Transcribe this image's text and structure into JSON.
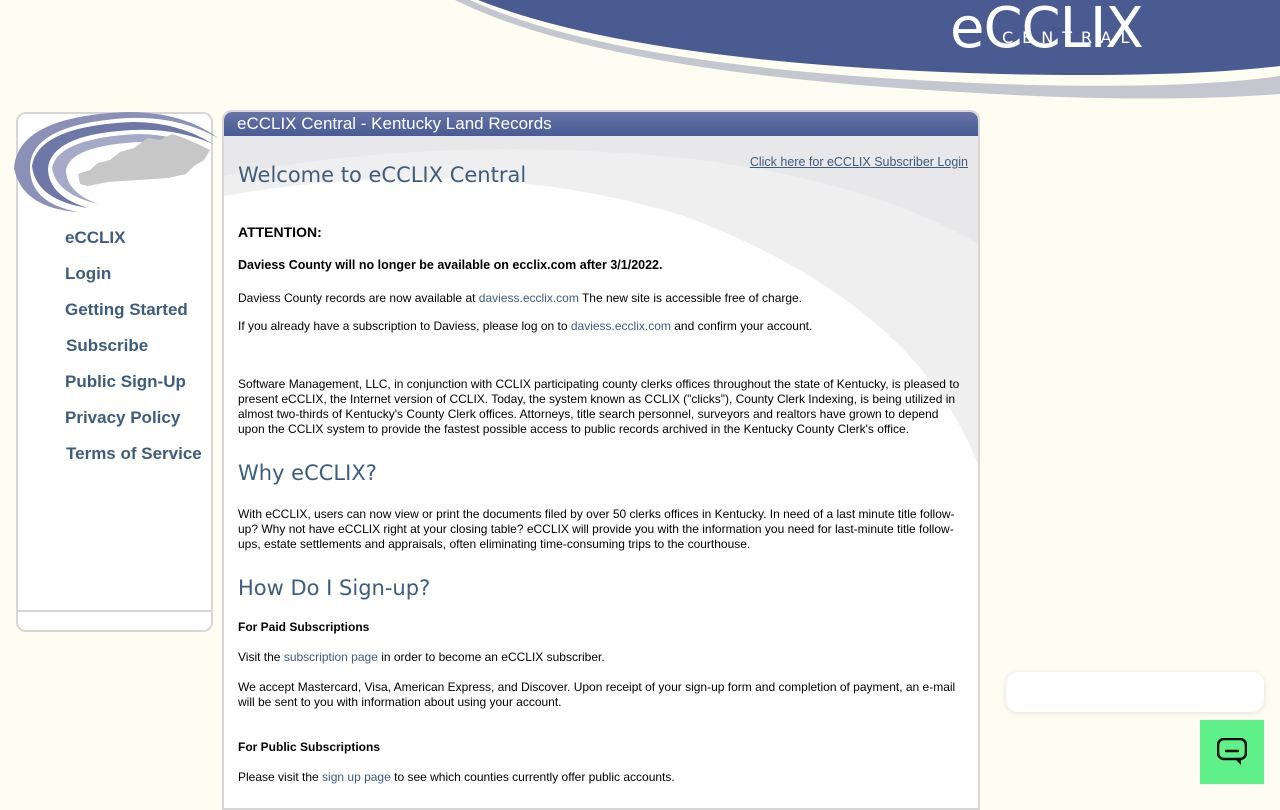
{
  "brand": {
    "logo_main": "eCCLIX",
    "logo_sub": "CENTRAL",
    "header_color": "#4a5b91"
  },
  "sidebar": {
    "items": [
      {
        "label": "eCCLIX"
      },
      {
        "label": "Login"
      },
      {
        "label": "Getting Started"
      },
      {
        "label": "Subscribe"
      },
      {
        "label": "Public Sign-Up"
      },
      {
        "label": "Privacy Policy"
      },
      {
        "label": "Terms of Service"
      }
    ]
  },
  "main": {
    "header_title": "eCCLIX Central - Kentucky Land Records",
    "login_link": "Click here for eCCLIX Subscriber Login",
    "welcome_title": "Welcome to eCCLIX Central",
    "attention_label": "ATTENTION:",
    "daviess_notice": "Daviess County will no longer be available on ecclix.com after 3/1/2022.",
    "daviess_records": {
      "pre": "Daviess County records are now available at ",
      "link": "daviess.ecclix.com",
      "post": " The new site is accessible free of charge."
    },
    "daviess_subscription": {
      "pre": "If you already have a subscription to Daviess, please log on to ",
      "link": "daviess.ecclix.com",
      "post": " and confirm your account."
    },
    "intro_paragraph": "Software Management, LLC, in conjunction with CCLIX participating county clerks offices throughout the state of Kentucky, is pleased to present eCCLIX, the Internet version of CCLIX. Today, the system known as CCLIX (\"clicks\"), County Clerk Indexing, is being utilized in almost two-thirds of Kentucky's County Clerk offices. Attorneys, title search personnel, surveyors and realtors have grown to depend upon the CCLIX system to provide the fastest possible access to public records archived in the Kentucky County Clerk's office.",
    "why_title": "Why eCCLIX?",
    "why_paragraph": "With eCCLIX, users can now view or print the documents filed by over 50 clerks offices in Kentucky. In need of a last minute title follow-up? Why not have eCCLIX right at your closing table? eCCLIX will provide you with the information you need for last-minute title follow-ups, estate settlements and appraisals, often eliminating time-consuming trips to the courthouse.",
    "signup_title": "How Do I Sign-up?",
    "paid_label": "For Paid Subscriptions",
    "paid_visit": {
      "pre": "Visit the ",
      "link": "subscription page",
      "post": " in order to become an eCCLIX subscriber."
    },
    "payment_paragraph": "We accept Mastercard, Visa, American Express, and Discover. Upon receipt of your sign-up form and completion of payment, an e-mail will be sent to you with information about using your account.",
    "public_label": "For Public Subscriptions",
    "public_visit": {
      "pre": "Please visit the ",
      "link": "sign up page",
      "post": " to see which counties currently offer public accounts."
    }
  },
  "chat": {
    "icon": "chat-bubble-icon",
    "color": "#5ff08a"
  }
}
